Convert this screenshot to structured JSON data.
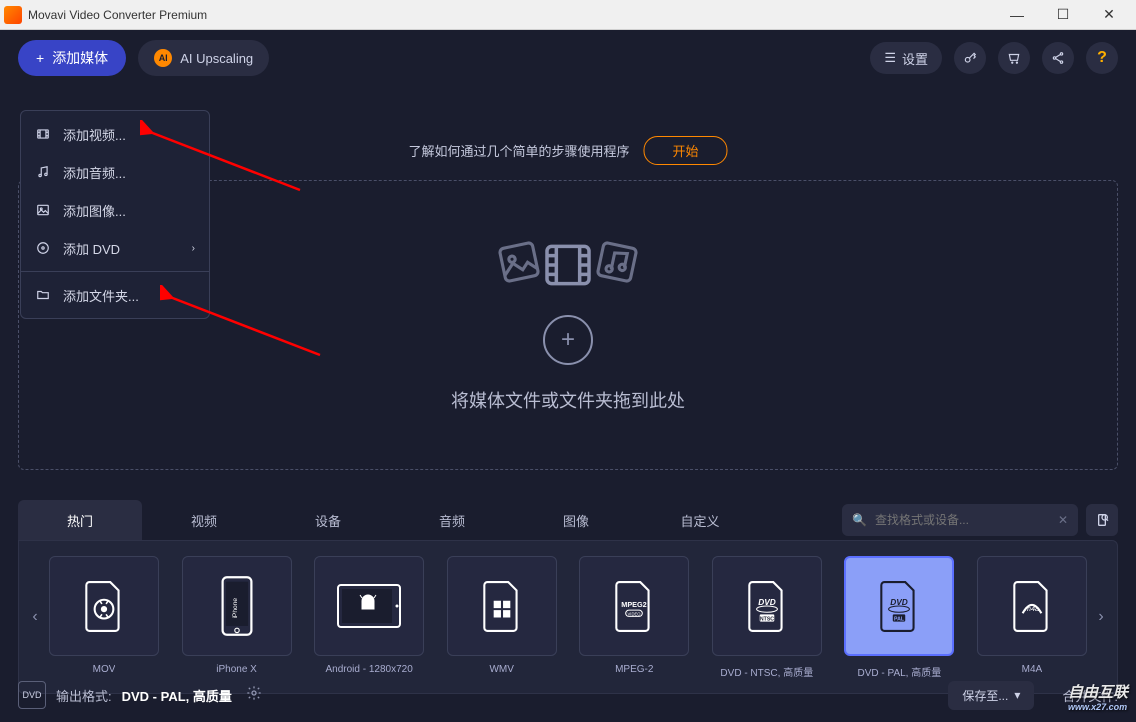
{
  "titlebar": {
    "title": "Movavi Video Converter Premium"
  },
  "toolbar": {
    "add_media": "添加媒体",
    "ai_upscale": "AI Upscaling",
    "ai_badge": "AI",
    "settings": "设置"
  },
  "dropdown": {
    "add_video": "添加视频...",
    "add_audio": "添加音频...",
    "add_image": "添加图像...",
    "add_dvd": "添加 DVD",
    "add_folder": "添加文件夹..."
  },
  "banner": {
    "info": "了解如何通过几个简单的步骤使用程序",
    "start": "开始"
  },
  "dropzone": {
    "text": "将媒体文件或文件夹拖到此处"
  },
  "tabs": {
    "items": [
      "热门",
      "视频",
      "设备",
      "音频",
      "图像",
      "自定义"
    ]
  },
  "search": {
    "placeholder": "查找格式或设备..."
  },
  "formats": [
    {
      "label": "MOV",
      "kind": "mov"
    },
    {
      "label": "iPhone X",
      "kind": "iphone"
    },
    {
      "label": "Android - 1280x720",
      "kind": "android"
    },
    {
      "label": "WMV",
      "kind": "wmv"
    },
    {
      "label": "MPEG-2",
      "kind": "mpeg2"
    },
    {
      "label": "DVD - NTSC, 高质量",
      "kind": "dvd-ntsc"
    },
    {
      "label": "DVD - PAL, 高质量",
      "kind": "dvd-pal",
      "selected": true
    },
    {
      "label": "M4A",
      "kind": "m4a"
    }
  ],
  "bottom": {
    "out_label": "输出格式: ",
    "out_format": "DVD - PAL, 高质量",
    "save_to": "保存至...",
    "merge": "合并文件:"
  },
  "watermark": {
    "main": "自由互联",
    "sub": "www.x27.com"
  }
}
